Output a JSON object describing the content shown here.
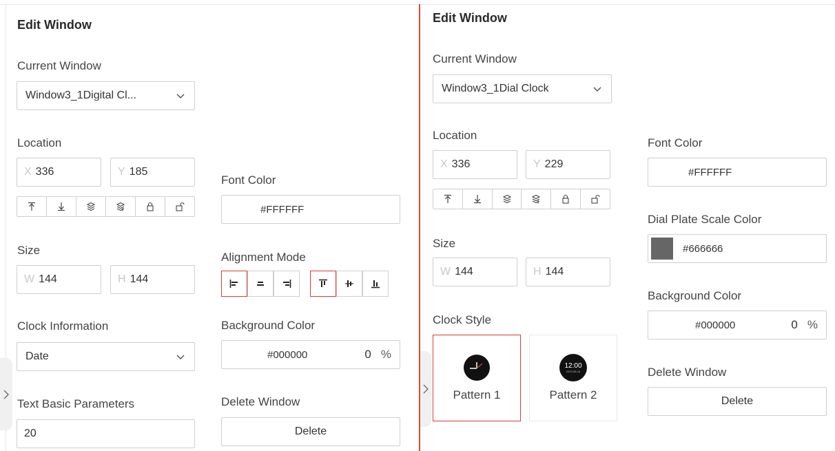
{
  "left": {
    "title": "Edit Window",
    "current_window": {
      "label": "Current Window",
      "value": "Window3_1Digital Cl..."
    },
    "location": {
      "label": "Location",
      "x_prefix": "X",
      "x": "336",
      "y_prefix": "Y",
      "y": "185"
    },
    "layer_icons": [
      "bring-to-front-icon",
      "send-to-back-icon",
      "bring-forward-icon",
      "send-backward-icon",
      "lock-icon",
      "unlock-icon"
    ],
    "size": {
      "label": "Size",
      "w_prefix": "W",
      "w": "144",
      "h_prefix": "H",
      "h": "144"
    },
    "clock_information": {
      "label": "Clock Information",
      "value": "Date"
    },
    "text_basic_parameters": {
      "label": "Text Basic Parameters",
      "value": "20"
    },
    "font_color": {
      "label": "Font Color",
      "value": "#FFFFFF"
    },
    "alignment_mode": {
      "label": "Alignment Mode"
    },
    "background_color": {
      "label": "Background Color",
      "value": "#000000",
      "opacity": "0",
      "unit": "%"
    },
    "delete_window": {
      "label": "Delete Window",
      "button": "Delete"
    }
  },
  "right": {
    "title": "Edit Window",
    "current_window": {
      "label": "Current Window",
      "value": "Window3_1Dial Clock"
    },
    "location": {
      "label": "Location",
      "x_prefix": "X",
      "x": "336",
      "y_prefix": "Y",
      "y": "229"
    },
    "size": {
      "label": "Size",
      "w_prefix": "W",
      "w": "144",
      "h_prefix": "H",
      "h": "144"
    },
    "clock_style": {
      "label": "Clock Style",
      "patterns": [
        {
          "label": "Pattern 1",
          "selected": true
        },
        {
          "label": "Pattern 2",
          "selected": false,
          "time": "12:00",
          "date": "2023-08-16"
        }
      ]
    },
    "font_color": {
      "label": "Font Color",
      "value": "#FFFFFF"
    },
    "dial_plate_scale_color": {
      "label": "Dial Plate Scale Color",
      "value": "#666666",
      "swatch": "#666666"
    },
    "background_color": {
      "label": "Background Color",
      "value": "#000000",
      "opacity": "0",
      "unit": "%"
    },
    "delete_window": {
      "label": "Delete Window",
      "button": "Delete"
    }
  },
  "colors": {
    "accent": "#d93a3a",
    "border": "#cfcfcf",
    "divider": "#e0453a"
  }
}
